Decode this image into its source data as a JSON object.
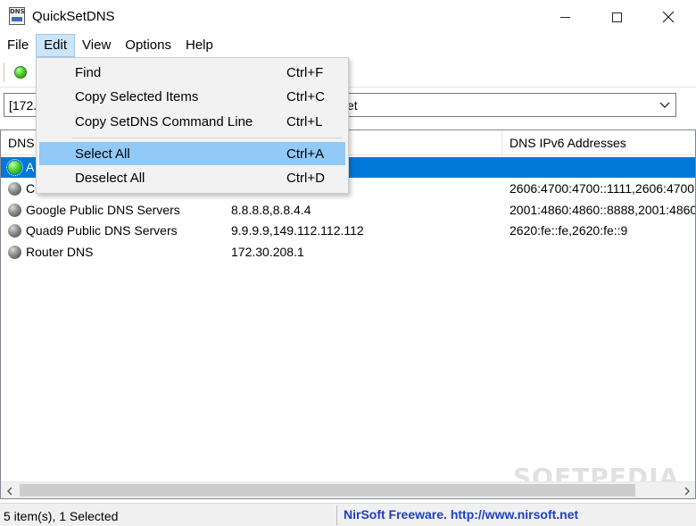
{
  "window": {
    "title": "QuickSetDNS",
    "icon_text": "DNS"
  },
  "menubar": {
    "items": [
      {
        "label": "File"
      },
      {
        "label": "Edit",
        "active": true
      },
      {
        "label": "View"
      },
      {
        "label": "Options"
      },
      {
        "label": "Help"
      }
    ]
  },
  "combo": {
    "value_left": "[172.",
    "value_right": "et"
  },
  "dropdown": {
    "items": [
      {
        "label": "Find",
        "shortcut": "Ctrl+F"
      },
      {
        "label": "Copy Selected Items",
        "shortcut": "Ctrl+C"
      },
      {
        "label": "Copy SetDNS Command Line",
        "shortcut": "Ctrl+L"
      },
      {
        "label": "Select All",
        "shortcut": "Ctrl+A",
        "hover": true
      },
      {
        "label": "Deselect All",
        "shortcut": "Ctrl+D"
      }
    ]
  },
  "listview": {
    "columns": [
      "DNS",
      "",
      "DNS IPv6 Addresses"
    ],
    "rows": [
      {
        "name": "A",
        "ipv4": "",
        "ipv6": "",
        "selected": true,
        "icon": "green-dot-icon"
      },
      {
        "name": "C",
        "ipv4": "",
        "ipv6": "2606:4700:4700::1111,2606:4700:",
        "icon": "gray-dot-icon"
      },
      {
        "name": "Google Public DNS Servers",
        "ipv4": "8.8.8.8,8.8.4.4",
        "ipv6": "2001:4860:4860::8888,2001:4860:",
        "icon": "gray-dot-icon"
      },
      {
        "name": "Quad9 Public DNS Servers",
        "ipv4": "9.9.9.9,149.112.112.112",
        "ipv6": "2620:fe::fe,2620:fe::9",
        "icon": "gray-dot-icon"
      },
      {
        "name": "Router DNS",
        "ipv4": "172.30.208.1",
        "ipv6": "",
        "icon": "gray-dot-icon"
      }
    ]
  },
  "watermark": "SOFTPEDIA",
  "statusbar": {
    "left": "5 item(s), 1 Selected",
    "right": "NirSoft Freeware.  http://www.nirsoft.net"
  }
}
